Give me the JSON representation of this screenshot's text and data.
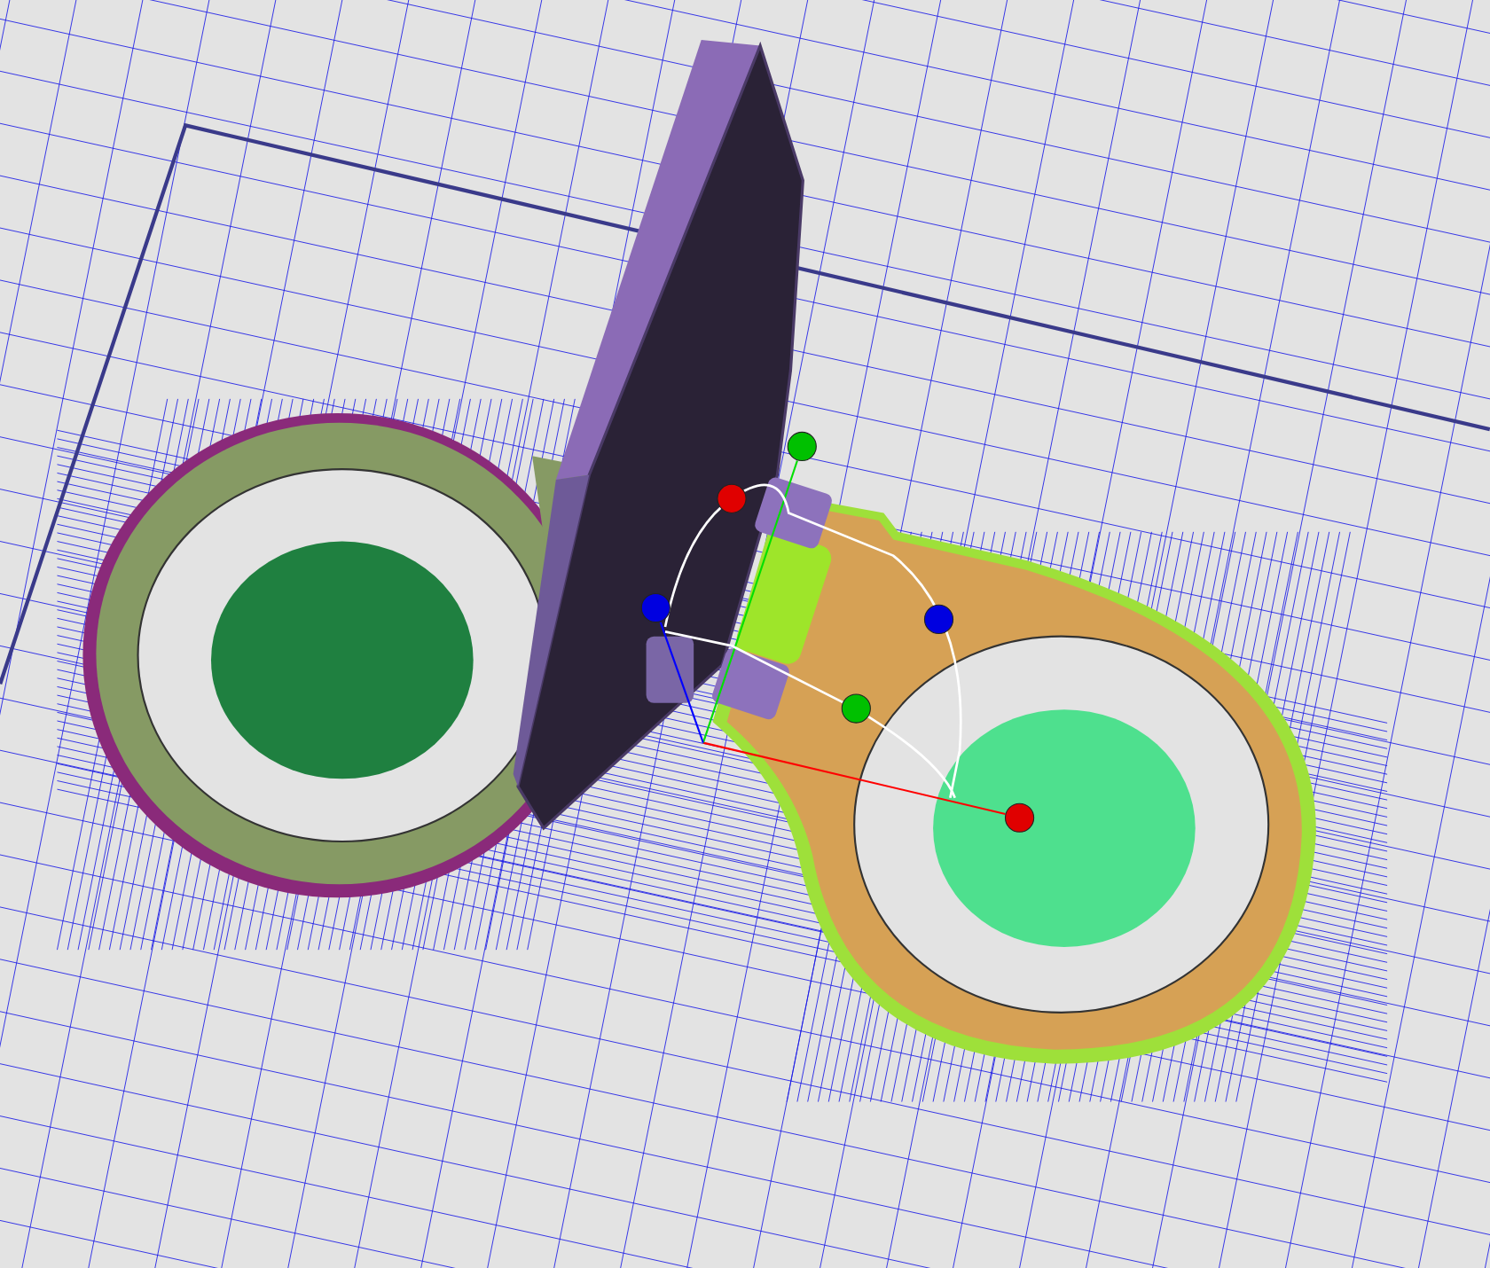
{
  "handles": [
    {
      "color": "#e00000"
    },
    {
      "color": "#e00000"
    },
    {
      "color": "#00c000"
    },
    {
      "color": "#00c000"
    },
    {
      "color": "#0000e0"
    },
    {
      "color": "#0000e0"
    }
  ]
}
